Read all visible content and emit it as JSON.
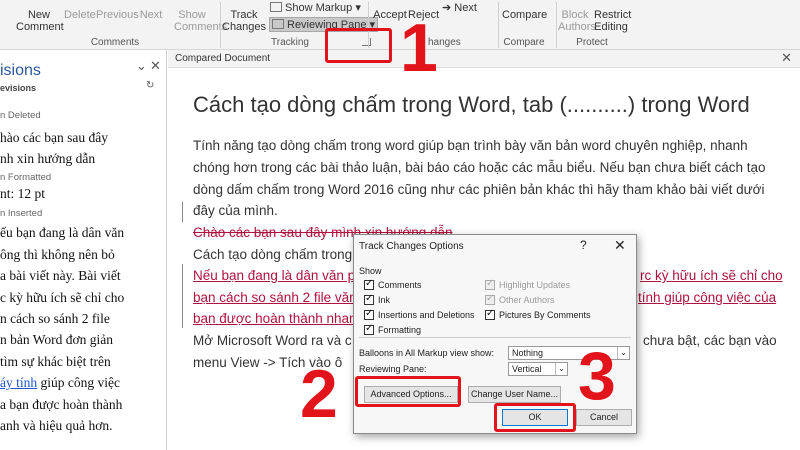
{
  "ribbon": {
    "comments_group": {
      "label": "Comments",
      "new_comment": "New Comment",
      "delete": "Delete",
      "previous": "Previous",
      "next": "Next",
      "show_comments": "Show Comments"
    },
    "tracking_group": {
      "label": "Tracking",
      "track_changes": "Track Changes",
      "show_markup": "Show Markup",
      "reviewing_pane": "Reviewing Pane"
    },
    "changes_group": {
      "label_partial": "hanges",
      "accept": "Accept",
      "reject": "Reject",
      "next": "Next"
    },
    "compare_group": {
      "label": "Compare",
      "compare": "Compare"
    },
    "protect_group": {
      "label": "Protect",
      "block_authors": "Block Authors",
      "restrict_editing": "Restrict Editing"
    }
  },
  "revisions_pane": {
    "title": "isions",
    "subtitle": "evisions",
    "lines": [
      {
        "text": "n Deleted",
        "kind": "meta"
      },
      {
        "text": "hào các bạn sau đây",
        "kind": "text"
      },
      {
        "text": "nh xin hướng dẫn",
        "kind": "text"
      },
      {
        "text": "n Formatted",
        "kind": "meta"
      },
      {
        "text": "nt: 12 pt",
        "kind": "text"
      },
      {
        "text": "n Inserted",
        "kind": "meta"
      },
      {
        "text": "ếu bạn đang là dân văn",
        "kind": "text"
      },
      {
        "text": "ông thì không nên bỏ",
        "kind": "text"
      },
      {
        "text": "a bài viết này. Bài viết",
        "kind": "text"
      },
      {
        "text": "c kỳ hữu ích sẽ chỉ cho",
        "kind": "text"
      },
      {
        "text": "n cách so sánh 2 file",
        "kind": "text"
      },
      {
        "text": "n bản Word đơn giản",
        "kind": "text"
      },
      {
        "text": "tìm sự khác biệt trên",
        "kind": "text"
      },
      {
        "text": "áy tính",
        "kind": "link",
        "suffix": " giúp công việc"
      },
      {
        "text": "a bạn được hoàn thành",
        "kind": "text"
      },
      {
        "text": "anh và hiệu quả hơn.",
        "kind": "text"
      }
    ]
  },
  "document": {
    "header": "Compared Document",
    "title": "Cách tạo dòng chấm trong Word, tab (..........) trong Word",
    "paragraph1": [
      "Tính năng tạo dòng chấm trong word giúp bạn trình bày văn bản word chuyên nghiệp, nhanh",
      "chóng hơn trong các bài thảo luận, bài báo cáo hoặc các mẫu biểu. Nếu bạn chưa biết cách tạo",
      "dòng dấm chấm trong Word 2016 cũng như các phiên bản khác thì hãy tham khảo bài viết dưới",
      "đây của mình."
    ],
    "deleted_line": "Chào các bạn sau đây mình xin hướng dẫn",
    "plain_line": "Cách tạo dòng chấm trong W",
    "inserted_lines": [
      {
        "left": "Nếu bạn đang là dân văn ph",
        "right": "rc kỳ hữu ích sẽ chỉ cho"
      },
      {
        "left": "bạn cách so sánh 2 file văn",
        "right": "tính giúp công việc của"
      },
      {
        "left": "bạn được hoàn thành nhanh",
        "right": ""
      }
    ],
    "para2_line1": {
      "left": "Mở Microsoft Word ra và c",
      "right": "chưa bật, các bạn vào"
    },
    "para2_line2": "menu View -> Tích vào ô"
  },
  "dialog": {
    "title": "Track Changes Options",
    "help": "?",
    "close": "✕",
    "show_label": "Show",
    "options": [
      {
        "label": "Comments",
        "checked": true,
        "enabled": true
      },
      {
        "label": "Ink",
        "checked": true,
        "enabled": true
      },
      {
        "label": "Insertions and Deletions",
        "checked": true,
        "enabled": true
      },
      {
        "label": "Formatting",
        "checked": true,
        "enabled": true
      },
      {
        "label": "Highlight Updates",
        "checked": true,
        "enabled": false
      },
      {
        "label": "Other Authors",
        "checked": true,
        "enabled": false
      },
      {
        "label": "Pictures By Comments",
        "checked": true,
        "enabled": true
      }
    ],
    "balloons_label": "Balloons in All Markup view show:",
    "balloons_value": "Nothing",
    "reviewing_pane_label": "Reviewing Pane:",
    "reviewing_pane_value": "Vertical",
    "advanced_options": "Advanced Options...",
    "change_user_name": "Change User Name...",
    "ok": "OK",
    "cancel": "Cancel"
  },
  "annotations": {
    "step1": "1",
    "step2": "2",
    "step3": "3",
    "color": "#e3131b"
  },
  "colors": {
    "accent": "#2b579a",
    "revision_red": "#b0123e",
    "ribbon_bg": "#f3f3f3"
  }
}
